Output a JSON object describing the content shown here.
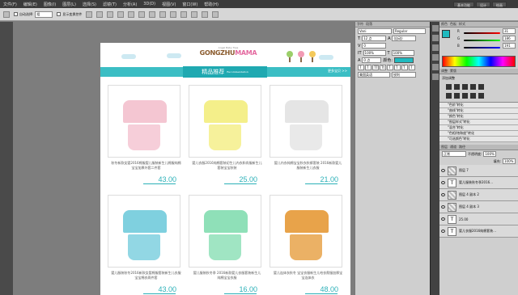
{
  "menu": {
    "items": [
      "文件(F)",
      "编辑(E)",
      "图像(I)",
      "图层(L)",
      "选择(S)",
      "滤镜(T)",
      "分析(A)",
      "3D(D)",
      "视图(V)",
      "窗口(W)",
      "帮助(H)"
    ],
    "workspace": [
      "基本功能",
      "设计",
      "绘画"
    ]
  },
  "options": {
    "auto_select": "自动选择:",
    "group": "组",
    "show_transform": "显示变换控件"
  },
  "page": {
    "logo_small": "Angel Baby Tops",
    "logo_a": "GONGZHU",
    "logo_b": "MAMA",
    "section_title": "精品推荐",
    "section_sub": "Recommendation",
    "more": "更多宝贝 >>"
  },
  "products": [
    {
      "title": "秋冬新款女婴2016棉服婴儿服装新生儿棉服纯棉宝宝加厚外套二件套",
      "price": "43.00",
      "color": "#f4c6d2"
    },
    {
      "title": "婴儿衣服2016纯棉套装初生儿内衣和尚服新生儿套装宝宝秋装",
      "price": "25.00",
      "color": "#f4ef8a"
    },
    {
      "title": "婴儿内衣纯棉宝宝秋衣秋裤套装 2016新款婴儿服装新生儿衣服",
      "price": "21.00",
      "color": "#e5e5e5"
    },
    {
      "title": "婴儿服装秋冬2016新款女婴棉服套装新生儿衣服宝宝棉衣两件套",
      "price": "43.00",
      "color": "#7fd0df"
    },
    {
      "title": "婴儿服装秋冬季 2016新款婴儿衣服套装新生儿纯棉宝宝衣服",
      "price": "16.00",
      "color": "#8fe0b8"
    },
    {
      "title": "婴儿连体衣秋冬 宝宝衣服新生儿哈衣爬服加厚宝宝连体衣",
      "price": "48.00",
      "color": "#e8a34a"
    }
  ],
  "char_panel": {
    "tabs": [
      "字符",
      "段落"
    ],
    "font": "Vani",
    "style": "Regular",
    "size": "12 点",
    "leading": "(自动)",
    "tracking": "0",
    "scale_v": "100%",
    "scale_h": "100%",
    "baseline": "0 点",
    "color_label": "颜色:",
    "lang": "美国英语",
    "aa": "锐利"
  },
  "color_panel": {
    "tabs": [
      "颜色",
      "色板",
      "样式"
    ],
    "r": "31",
    "g": "186",
    "b": "191",
    "accent": "#1fbabf"
  },
  "actions_panel": {
    "tabs": [
      "调整",
      "蒙版"
    ],
    "label": "添加调整",
    "items": [
      "\"色阶\"转化",
      "\"曲线\"转化",
      "\"颜色\"转化",
      "\"图层样式\"转化",
      "\"混合\"转化",
      "\"色相/饱和度\"转化",
      "\"可选颜色\"转化"
    ]
  },
  "layers_panel": {
    "tabs": [
      "图层",
      "通道",
      "路径"
    ],
    "blend": "正常",
    "opacity_label": "不透明度:",
    "opacity": "100%",
    "fill_label": "填充:",
    "fill": "100%",
    "layers": [
      {
        "name": "图层 7",
        "type": "pix"
      },
      {
        "name": "婴儿服装秋冬季2016...",
        "type": "T"
      },
      {
        "name": "图层 4 副本 2",
        "type": "pix"
      },
      {
        "name": "图层 4 副本 3",
        "type": "pix"
      },
      {
        "name": "25.00",
        "type": "T"
      },
      {
        "name": "婴儿衣服2016纯棉套装...",
        "type": "T"
      }
    ]
  }
}
